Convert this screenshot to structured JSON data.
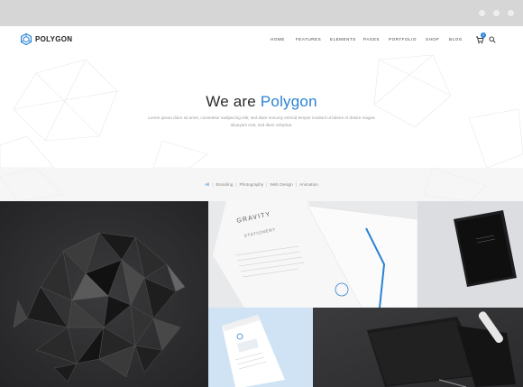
{
  "brand": {
    "name": "POLYGON",
    "accent": "#2a82d4"
  },
  "nav": {
    "items": [
      "HOME",
      "FEATURES",
      "ELEMENTS",
      "PAGES",
      "PORTFOLIO",
      "SHOP",
      "BLOG"
    ],
    "cart_count": "0",
    "icons": [
      "cart-icon",
      "search-icon"
    ]
  },
  "hero": {
    "title_prefix": "We are ",
    "title_accent": "Polygon",
    "text": "Lorem ipsum dolor sit amet, consetetur sadipscing elitr, sed diam nonumy eirmod tempor invidunt ut labore et dolore magna aliquyam erat, sed diam voluptua."
  },
  "filters": {
    "items": [
      "All",
      "Branding",
      "Photography",
      "Web Design",
      "Animation"
    ],
    "active": "All",
    "separator": "|"
  },
  "gallery": {
    "t2_texts": {
      "title": "GRAVITY",
      "subtitle": "STATIONERY"
    }
  }
}
